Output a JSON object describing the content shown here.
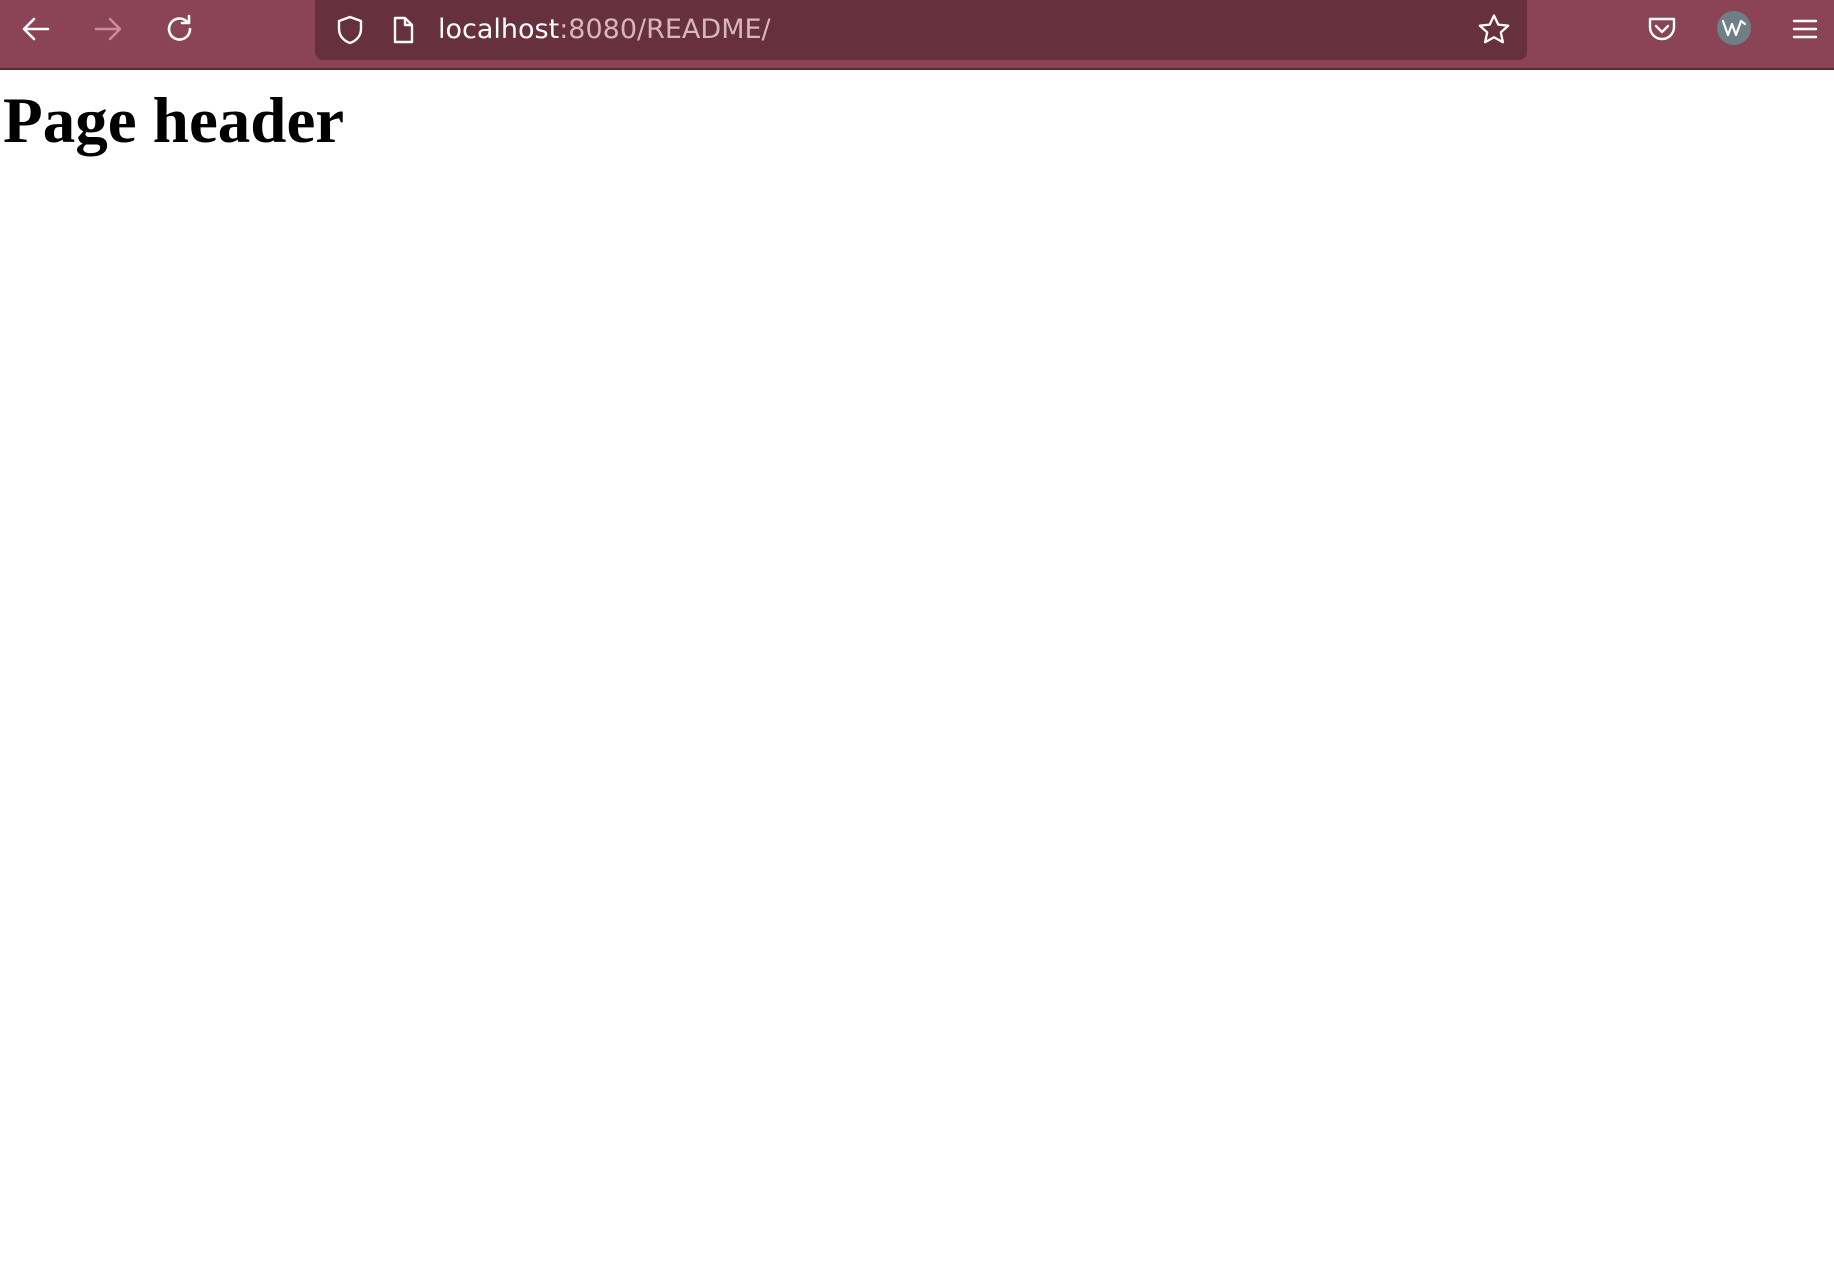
{
  "browser": {
    "address_bar": {
      "host": "localhost",
      "path": ":8080/README/"
    },
    "toolbar": {
      "icons": {
        "back": "back-arrow-icon",
        "forward": "forward-arrow-icon",
        "reload": "reload-icon",
        "tracking_protection": "shield-icon",
        "page_info": "page-icon",
        "bookmark": "star-icon",
        "pocket": "pocket-icon",
        "account": "account-avatar-icon",
        "menu": "hamburger-menu-icon"
      },
      "forward_enabled": false
    },
    "colors": {
      "toolbar_bg": "#8b4455",
      "urlbar_bg": "#66303c",
      "url_secondary_text": "#d9b5bd"
    }
  },
  "page": {
    "header": "Page header"
  }
}
